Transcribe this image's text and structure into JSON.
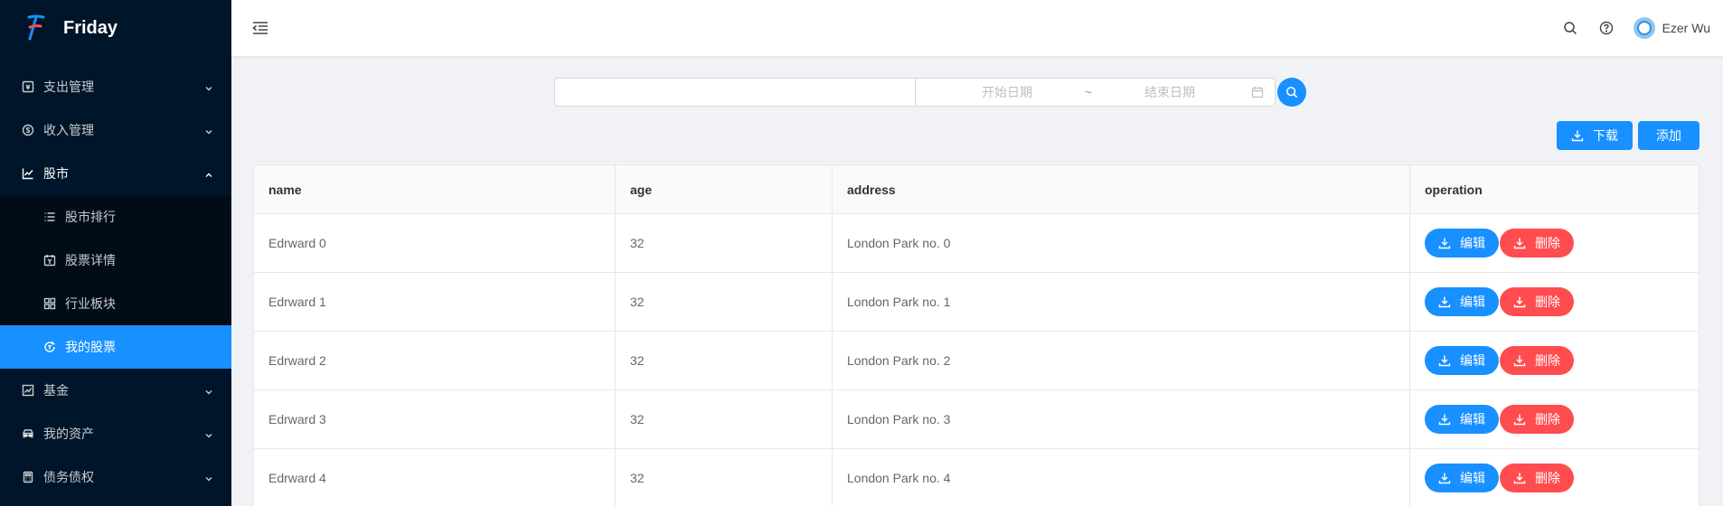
{
  "app": {
    "name": "Friday",
    "brand_color": "#1890ff"
  },
  "sidebar": {
    "items": [
      {
        "label": "支出管理",
        "icon": "wallet-icon"
      },
      {
        "label": "收入管理",
        "icon": "dollar-circle-icon"
      },
      {
        "label": "股市",
        "icon": "stock-line-icon",
        "open": true
      },
      {
        "label": "基金",
        "icon": "fund-chart-icon"
      },
      {
        "label": "我的资产",
        "icon": "car-icon"
      },
      {
        "label": "债务债权",
        "icon": "calculator-icon"
      }
    ],
    "submenu": [
      {
        "label": "股市排行",
        "icon": "list-icon"
      },
      {
        "label": "股票详情",
        "icon": "calendar-icon"
      },
      {
        "label": "行业板块",
        "icon": "grid-icon"
      },
      {
        "label": "我的股票",
        "icon": "refresh-circle-icon",
        "selected": true
      }
    ]
  },
  "header": {
    "user_name": "Ezer Wu"
  },
  "search": {
    "text_value": "",
    "start_placeholder": "开始日期",
    "separator": "~",
    "end_placeholder": "结束日期"
  },
  "actions": {
    "download_label": "下载",
    "add_label": "添加"
  },
  "table": {
    "columns": [
      "name",
      "age",
      "address",
      "operation"
    ],
    "rows": [
      {
        "name": "Edrward 0",
        "age": "32",
        "address": "London Park no. 0"
      },
      {
        "name": "Edrward 1",
        "age": "32",
        "address": "London Park no. 1"
      },
      {
        "name": "Edrward 2",
        "age": "32",
        "address": "London Park no. 2"
      },
      {
        "name": "Edrward 3",
        "age": "32",
        "address": "London Park no. 3"
      },
      {
        "name": "Edrward 4",
        "age": "32",
        "address": "London Park no. 4"
      }
    ],
    "edit_label": "编辑",
    "delete_label": "删除"
  }
}
